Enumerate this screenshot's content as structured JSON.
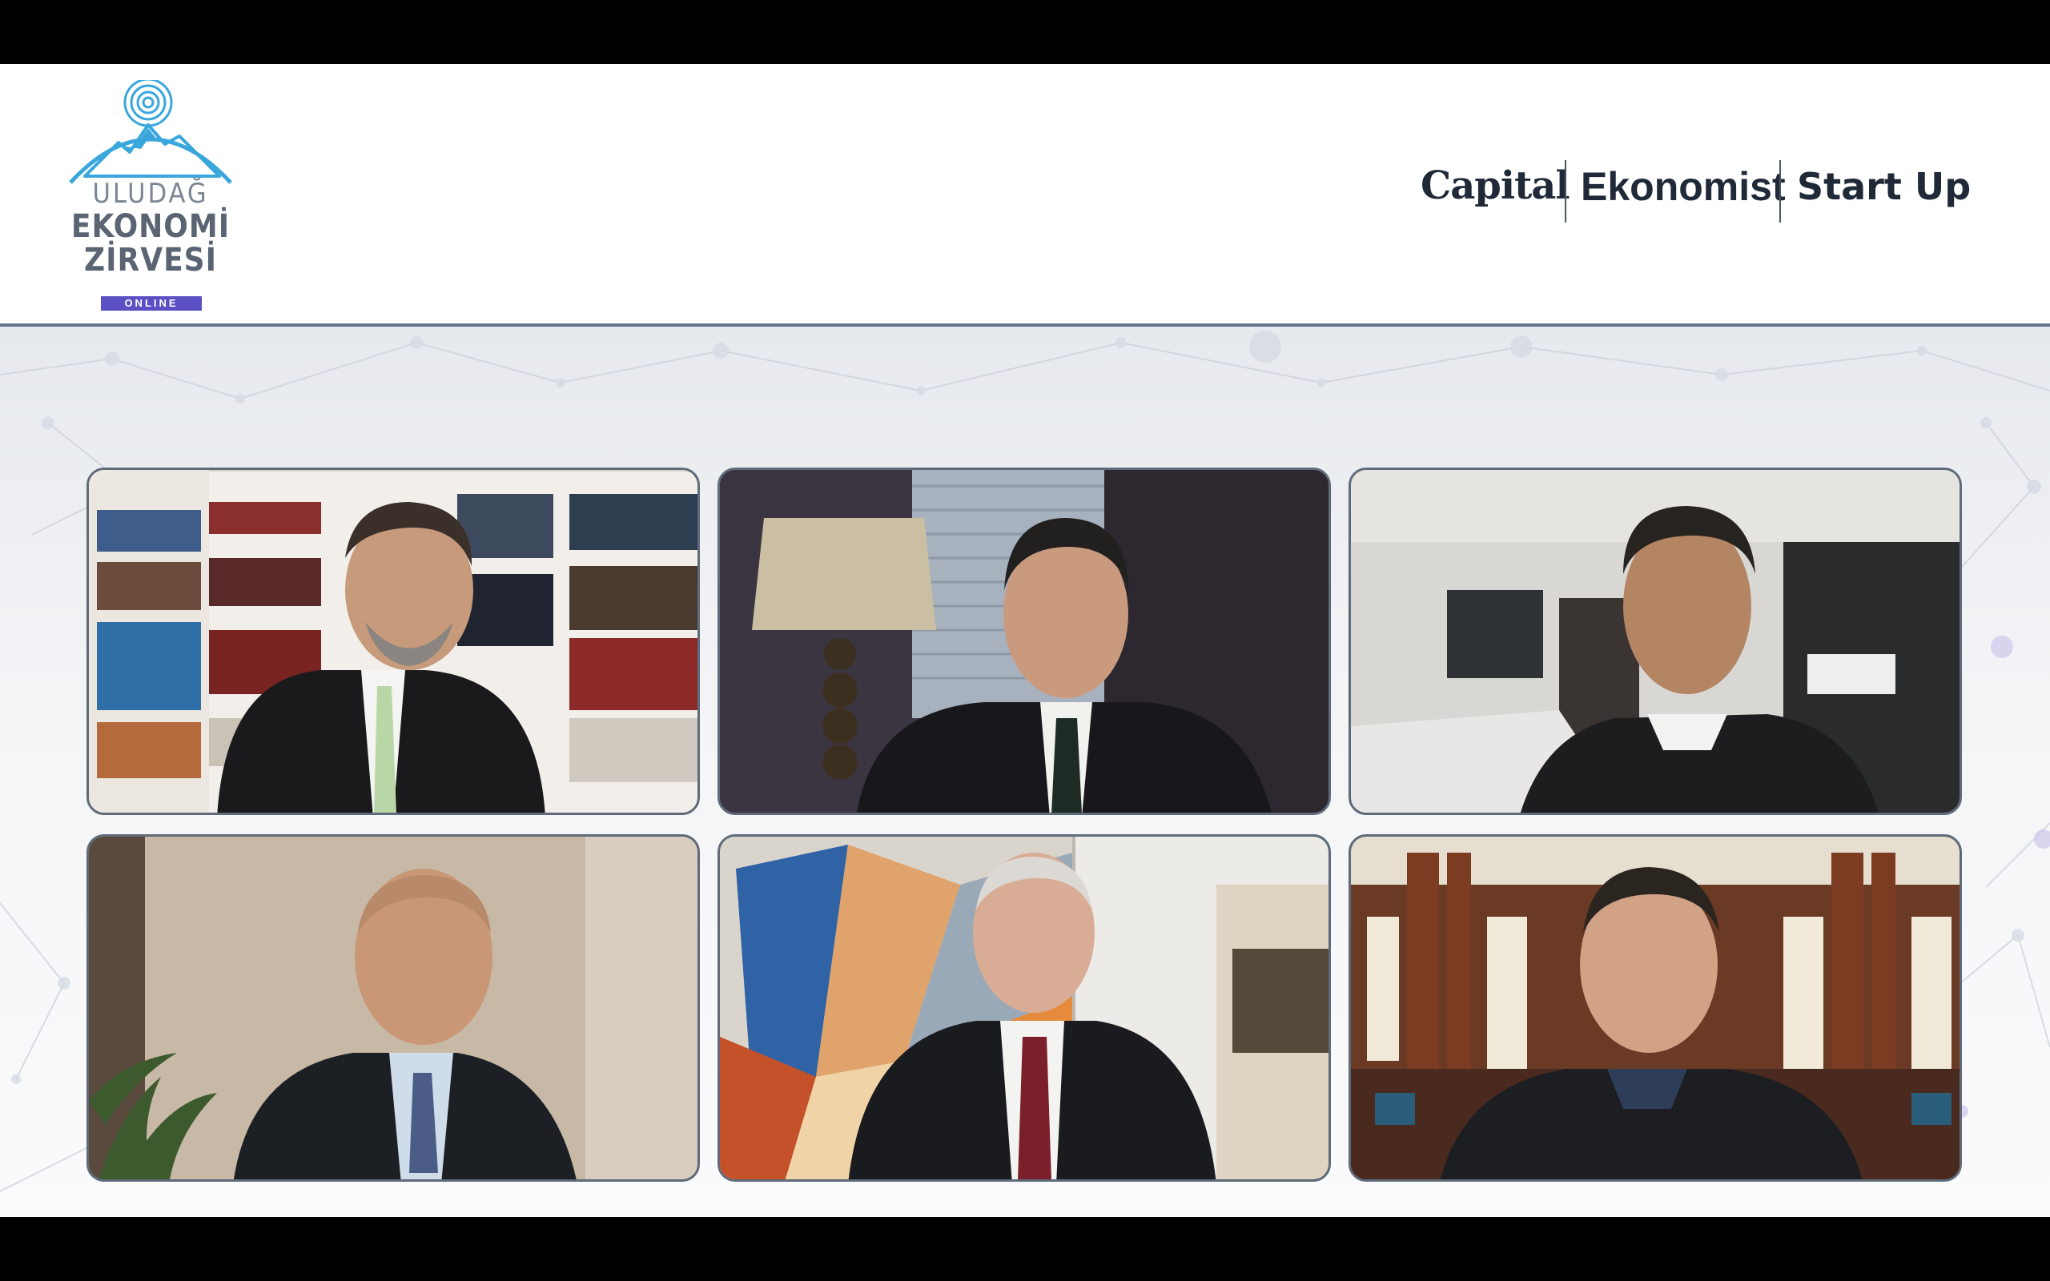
{
  "event": {
    "logo": {
      "line1": "ULUDAĞ",
      "line2": "EKONOMİ",
      "line3": "ZİRVESİ",
      "badge": "ONLINE"
    },
    "brands": [
      "Capital",
      "Ekonomist",
      "Start Up"
    ]
  },
  "colors": {
    "logo_blue": "#3aa7dc",
    "logo_badge": "#5b4fc4",
    "header_rule": "#64748b",
    "tile_border": "#5f6b7a"
  },
  "video_tiles": [
    {
      "position": "row1-col1",
      "setting": "bookshelf-office",
      "attire": "dark suit, light green tie"
    },
    {
      "position": "row1-col2",
      "setting": "office with lamp and blinds",
      "attire": "dark suit, dark tie"
    },
    {
      "position": "row1-col3",
      "setting": "modern living room",
      "attire": "dark sweater, white collar"
    },
    {
      "position": "row2-col1",
      "setting": "beige room with plant",
      "attire": "dark suit, blue tie"
    },
    {
      "position": "row2-col2",
      "setting": "abstract painting and TV",
      "attire": "dark suit, red tie"
    },
    {
      "position": "row2-col3",
      "setting": "historic library",
      "attire": "dark jacket, open collar"
    }
  ]
}
